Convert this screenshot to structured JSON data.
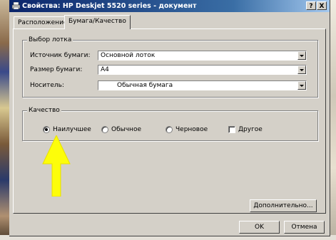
{
  "window": {
    "title": "Свойства: HP Deskjet 5520 series - документ",
    "help_button": "?",
    "close_button": "X"
  },
  "tabs": [
    {
      "label": "Расположение",
      "active": false
    },
    {
      "label": "Бумага/Качество",
      "active": true
    }
  ],
  "tray_group": {
    "legend": "Выбор лотка",
    "fields": [
      {
        "label": "Источник бумаги:",
        "value": "Основной лоток"
      },
      {
        "label": "Размер бумаги:",
        "value": "A4"
      },
      {
        "label": "Носитель:",
        "value": "Обычная бумага"
      }
    ]
  },
  "quality_group": {
    "legend": "Качество",
    "options": [
      {
        "label": "Наилучшее",
        "selected": true
      },
      {
        "label": "Обычное",
        "selected": false
      },
      {
        "label": "Черновое",
        "selected": false
      }
    ],
    "custom_checkbox": {
      "label": "Другое",
      "checked": false
    }
  },
  "buttons": {
    "advanced": "Дополнительно...",
    "ok": "OK",
    "cancel": "Отмена"
  },
  "colors": {
    "titlebar_start": "#0a246a",
    "titlebar_end": "#a6caf0",
    "dialog_face": "#d4d0c8",
    "annotation_arrow": "#ffff00"
  }
}
